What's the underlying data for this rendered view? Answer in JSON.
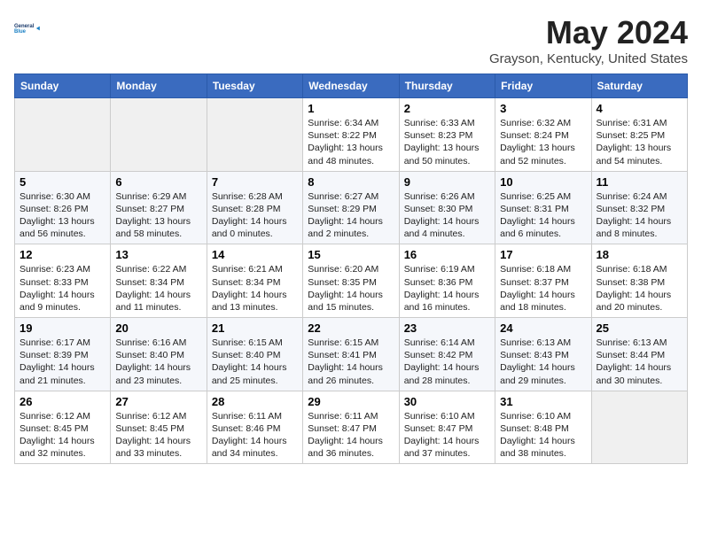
{
  "header": {
    "logo_line1": "General",
    "logo_line2": "Blue",
    "title": "May 2024",
    "subtitle": "Grayson, Kentucky, United States"
  },
  "columns": [
    "Sunday",
    "Monday",
    "Tuesday",
    "Wednesday",
    "Thursday",
    "Friday",
    "Saturday"
  ],
  "weeks": [
    [
      {
        "day": "",
        "info": ""
      },
      {
        "day": "",
        "info": ""
      },
      {
        "day": "",
        "info": ""
      },
      {
        "day": "1",
        "info": "Sunrise: 6:34 AM\nSunset: 8:22 PM\nDaylight: 13 hours\nand 48 minutes."
      },
      {
        "day": "2",
        "info": "Sunrise: 6:33 AM\nSunset: 8:23 PM\nDaylight: 13 hours\nand 50 minutes."
      },
      {
        "day": "3",
        "info": "Sunrise: 6:32 AM\nSunset: 8:24 PM\nDaylight: 13 hours\nand 52 minutes."
      },
      {
        "day": "4",
        "info": "Sunrise: 6:31 AM\nSunset: 8:25 PM\nDaylight: 13 hours\nand 54 minutes."
      }
    ],
    [
      {
        "day": "5",
        "info": "Sunrise: 6:30 AM\nSunset: 8:26 PM\nDaylight: 13 hours\nand 56 minutes."
      },
      {
        "day": "6",
        "info": "Sunrise: 6:29 AM\nSunset: 8:27 PM\nDaylight: 13 hours\nand 58 minutes."
      },
      {
        "day": "7",
        "info": "Sunrise: 6:28 AM\nSunset: 8:28 PM\nDaylight: 14 hours\nand 0 minutes."
      },
      {
        "day": "8",
        "info": "Sunrise: 6:27 AM\nSunset: 8:29 PM\nDaylight: 14 hours\nand 2 minutes."
      },
      {
        "day": "9",
        "info": "Sunrise: 6:26 AM\nSunset: 8:30 PM\nDaylight: 14 hours\nand 4 minutes."
      },
      {
        "day": "10",
        "info": "Sunrise: 6:25 AM\nSunset: 8:31 PM\nDaylight: 14 hours\nand 6 minutes."
      },
      {
        "day": "11",
        "info": "Sunrise: 6:24 AM\nSunset: 8:32 PM\nDaylight: 14 hours\nand 8 minutes."
      }
    ],
    [
      {
        "day": "12",
        "info": "Sunrise: 6:23 AM\nSunset: 8:33 PM\nDaylight: 14 hours\nand 9 minutes."
      },
      {
        "day": "13",
        "info": "Sunrise: 6:22 AM\nSunset: 8:34 PM\nDaylight: 14 hours\nand 11 minutes."
      },
      {
        "day": "14",
        "info": "Sunrise: 6:21 AM\nSunset: 8:34 PM\nDaylight: 14 hours\nand 13 minutes."
      },
      {
        "day": "15",
        "info": "Sunrise: 6:20 AM\nSunset: 8:35 PM\nDaylight: 14 hours\nand 15 minutes."
      },
      {
        "day": "16",
        "info": "Sunrise: 6:19 AM\nSunset: 8:36 PM\nDaylight: 14 hours\nand 16 minutes."
      },
      {
        "day": "17",
        "info": "Sunrise: 6:18 AM\nSunset: 8:37 PM\nDaylight: 14 hours\nand 18 minutes."
      },
      {
        "day": "18",
        "info": "Sunrise: 6:18 AM\nSunset: 8:38 PM\nDaylight: 14 hours\nand 20 minutes."
      }
    ],
    [
      {
        "day": "19",
        "info": "Sunrise: 6:17 AM\nSunset: 8:39 PM\nDaylight: 14 hours\nand 21 minutes."
      },
      {
        "day": "20",
        "info": "Sunrise: 6:16 AM\nSunset: 8:40 PM\nDaylight: 14 hours\nand 23 minutes."
      },
      {
        "day": "21",
        "info": "Sunrise: 6:15 AM\nSunset: 8:40 PM\nDaylight: 14 hours\nand 25 minutes."
      },
      {
        "day": "22",
        "info": "Sunrise: 6:15 AM\nSunset: 8:41 PM\nDaylight: 14 hours\nand 26 minutes."
      },
      {
        "day": "23",
        "info": "Sunrise: 6:14 AM\nSunset: 8:42 PM\nDaylight: 14 hours\nand 28 minutes."
      },
      {
        "day": "24",
        "info": "Sunrise: 6:13 AM\nSunset: 8:43 PM\nDaylight: 14 hours\nand 29 minutes."
      },
      {
        "day": "25",
        "info": "Sunrise: 6:13 AM\nSunset: 8:44 PM\nDaylight: 14 hours\nand 30 minutes."
      }
    ],
    [
      {
        "day": "26",
        "info": "Sunrise: 6:12 AM\nSunset: 8:45 PM\nDaylight: 14 hours\nand 32 minutes."
      },
      {
        "day": "27",
        "info": "Sunrise: 6:12 AM\nSunset: 8:45 PM\nDaylight: 14 hours\nand 33 minutes."
      },
      {
        "day": "28",
        "info": "Sunrise: 6:11 AM\nSunset: 8:46 PM\nDaylight: 14 hours\nand 34 minutes."
      },
      {
        "day": "29",
        "info": "Sunrise: 6:11 AM\nSunset: 8:47 PM\nDaylight: 14 hours\nand 36 minutes."
      },
      {
        "day": "30",
        "info": "Sunrise: 6:10 AM\nSunset: 8:47 PM\nDaylight: 14 hours\nand 37 minutes."
      },
      {
        "day": "31",
        "info": "Sunrise: 6:10 AM\nSunset: 8:48 PM\nDaylight: 14 hours\nand 38 minutes."
      },
      {
        "day": "",
        "info": ""
      }
    ]
  ]
}
